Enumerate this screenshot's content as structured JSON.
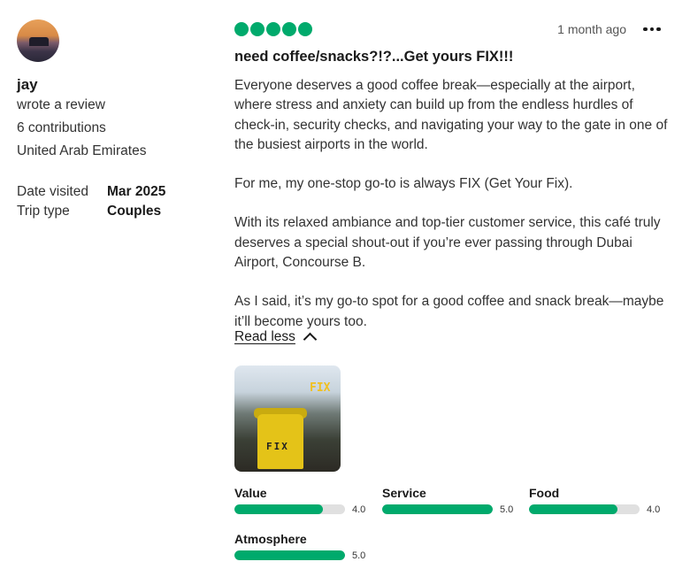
{
  "reviewer": {
    "name": "jay",
    "action": "wrote a review",
    "contributions": "6 contributions",
    "location": "United Arab Emirates"
  },
  "details": {
    "date_label": "Date visited",
    "date_value": "Mar 2025",
    "trip_label": "Trip type",
    "trip_value": "Couples"
  },
  "review": {
    "rating_bubbles": 5,
    "date": "1 month ago",
    "title": "need coffee/snacks?!?...Get yours FIX!!!",
    "paragraphs": [
      "Everyone deserves a good coffee break—especially at the airport, where stress and anxiety can build up from the endless hurdles of check-in, security checks, and navigating your way to the gate in one of the busiest airports in the world.",
      "For me, my one-stop go-to is always FIX (Get Your Fix).",
      "With its relaxed ambiance and top-tier customer service, this café truly deserves a special shout-out if you’re ever passing through Dubai Airport, Concourse B.",
      "As I said, it’s my go-to spot for a good coffee and snack break—maybe it’ll become yours too."
    ],
    "read_less": "Read less"
  },
  "ratings": [
    {
      "label": "Value",
      "value": "4.0",
      "score": 4
    },
    {
      "label": "Service",
      "value": "5.0",
      "score": 5
    },
    {
      "label": "Food",
      "value": "4.0",
      "score": 4
    },
    {
      "label": "Atmosphere",
      "value": "5.0",
      "score": 5
    }
  ],
  "colors": {
    "accent": "#00aa6c",
    "track": "#e0e0e0"
  },
  "icons": {
    "more": "more-dots-icon",
    "chevron": "chevron-up-icon"
  }
}
